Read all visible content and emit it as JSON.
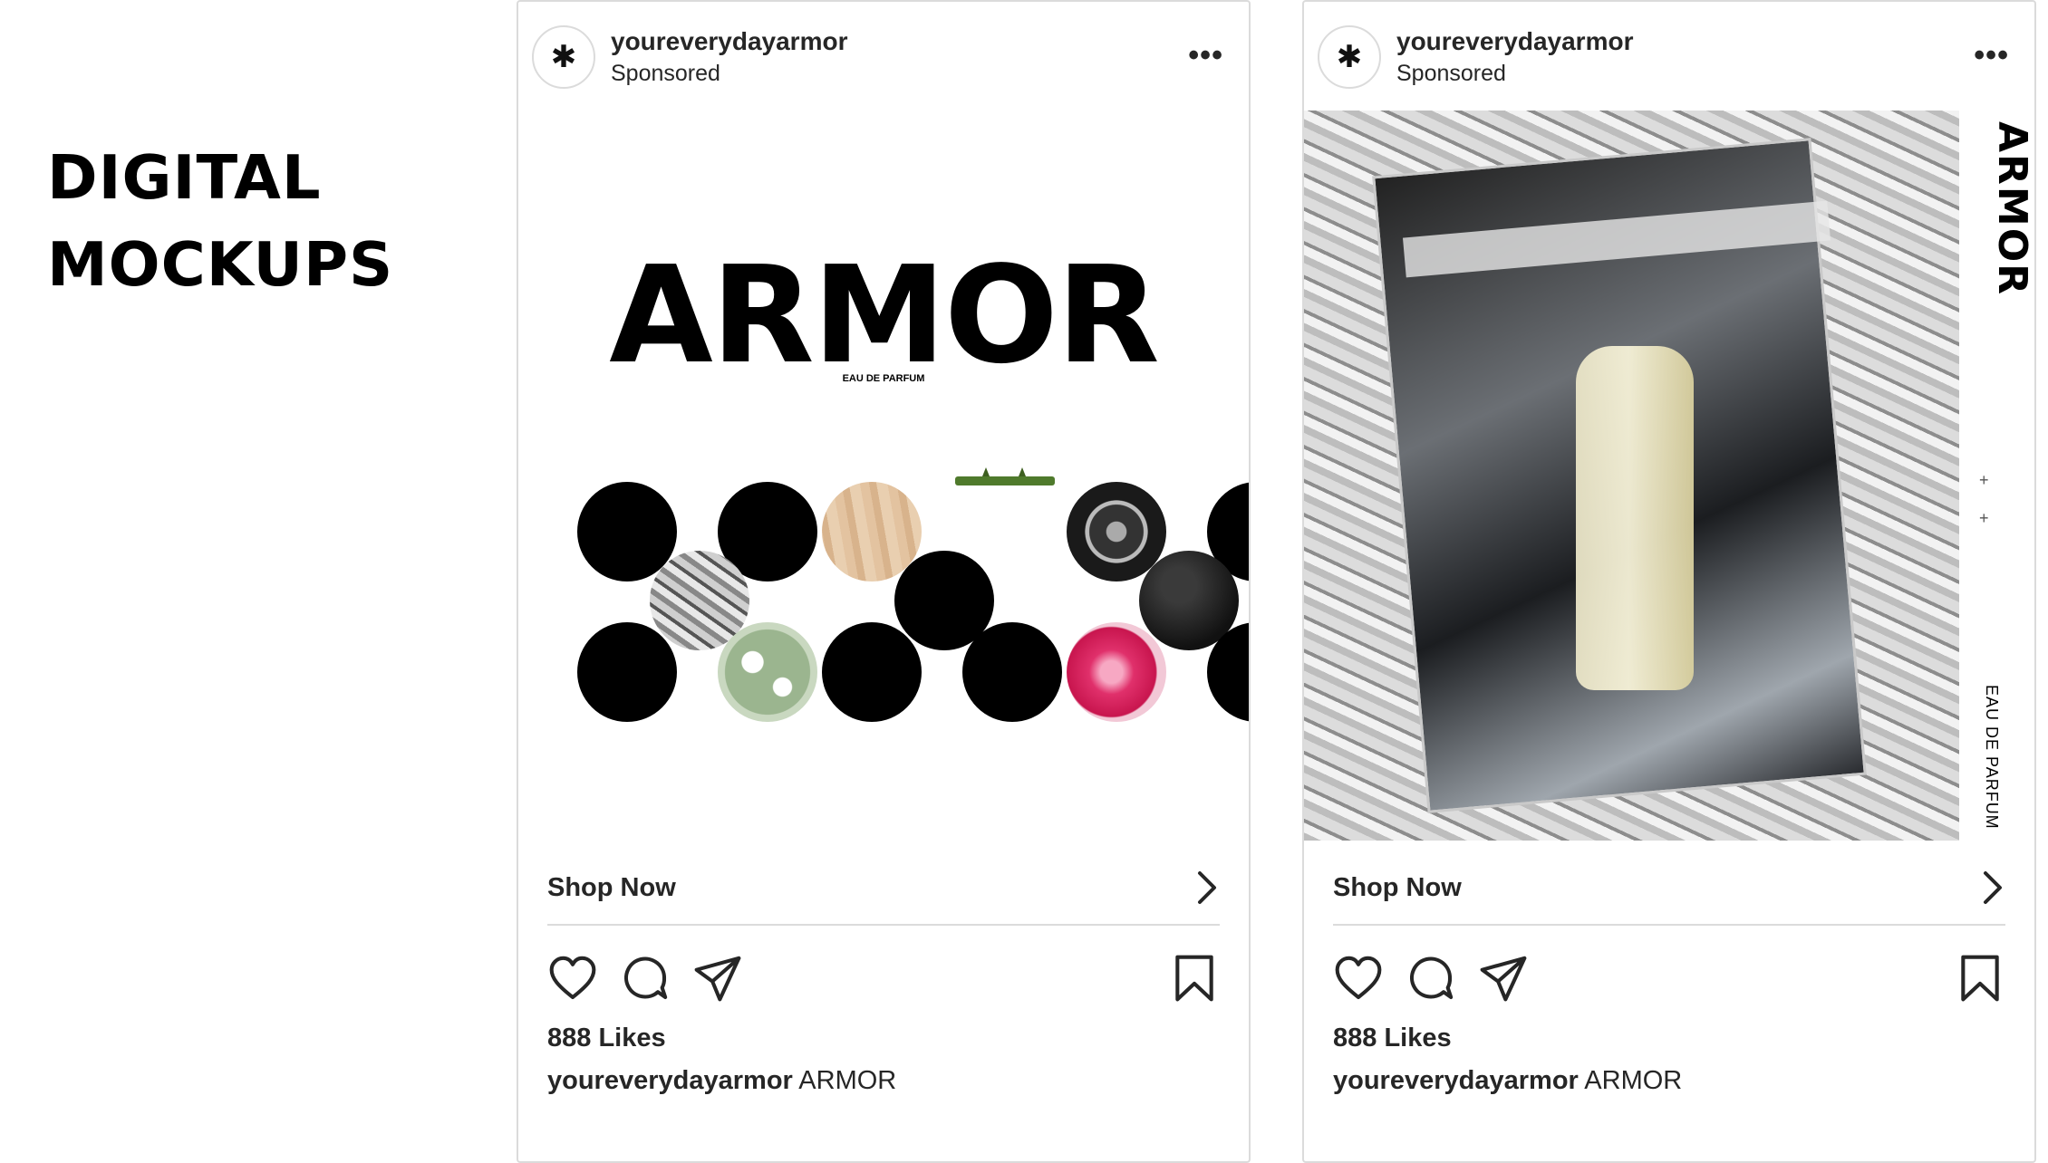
{
  "heading": {
    "line1": "DIGITAL",
    "line2": "MOCKUPS"
  },
  "posts": [
    {
      "username": "youreverydayarmor",
      "sponsored": "Sponsored",
      "media": {
        "wordmark": "ARMOR",
        "subtitle": "EAU DE PARFUM"
      },
      "shop_label": "Shop Now",
      "likes": "888 Likes",
      "caption_user": "youreverydayarmor",
      "caption_text": "ARMOR"
    },
    {
      "username": "youreverydayarmor",
      "sponsored": "Sponsored",
      "media": {
        "wordmark": "ARMOR",
        "subtitle": "EAU DE PARFUM"
      },
      "shop_label": "Shop Now",
      "likes": "888 Likes",
      "caption_user": "youreverydayarmor",
      "caption_text": "ARMOR"
    }
  ],
  "icons": [
    "more-icon",
    "chevron-right-icon",
    "heart-icon",
    "comment-icon",
    "share-icon",
    "bookmark-icon"
  ]
}
